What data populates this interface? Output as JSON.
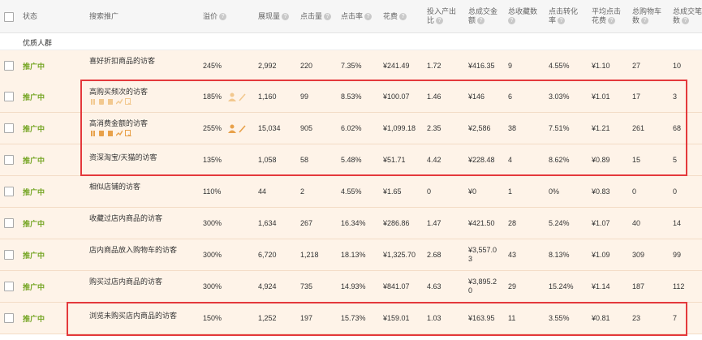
{
  "header": {
    "status": "状态",
    "promo": "搜索推广",
    "premium": "溢价",
    "impressions": "展现量",
    "clicks": "点击量",
    "ctr": "点击率",
    "cost": "花费",
    "roi_l1": "投入产出",
    "roi_l2": "比",
    "gmv_l1": "总成交金",
    "gmv_l2": "额",
    "fav": "总收藏数",
    "cvr_l1": "点击转化",
    "cvr_l2": "率",
    "cpc_l1": "平均点击",
    "cpc_l2": "花费",
    "cart_l1": "总购物车",
    "cart_l2": "数",
    "orders_l1": "总成交笔",
    "orders_l2": "数"
  },
  "group_label": "优质人群",
  "help_icon": "?",
  "rows": [
    {
      "status": "推广中",
      "name": "喜好折扣商品的访客",
      "premium": "245%",
      "impressions": "2,992",
      "clicks": "220",
      "ctr": "7.35%",
      "cost": "¥241.49",
      "roi": "1.72",
      "gmv": "¥416.35",
      "gmv2": "",
      "fav": "9",
      "cvr": "4.55%",
      "cpc": "¥1.10",
      "cart": "27",
      "orders": "10"
    },
    {
      "status": "推广中",
      "name": "高购买频次的访客",
      "premium": "185%",
      "impressions": "1,160",
      "clicks": "99",
      "ctr": "8.53%",
      "cost": "¥100.07",
      "roi": "1.46",
      "gmv": "¥146",
      "gmv2": "",
      "fav": "6",
      "cvr": "3.03%",
      "cpc": "¥1.01",
      "cart": "17",
      "orders": "3"
    },
    {
      "status": "推广中",
      "name": "高消费金额的访客",
      "premium": "255%",
      "impressions": "15,034",
      "clicks": "905",
      "ctr": "6.02%",
      "cost": "¥1,099.18",
      "roi": "2.35",
      "gmv": "¥2,586",
      "gmv2": "",
      "fav": "38",
      "cvr": "7.51%",
      "cpc": "¥1.21",
      "cart": "261",
      "orders": "68"
    },
    {
      "status": "推广中",
      "name": "资深淘宝/天猫的访客",
      "premium": "135%",
      "impressions": "1,058",
      "clicks": "58",
      "ctr": "5.48%",
      "cost": "¥51.71",
      "roi": "4.42",
      "gmv": "¥228.48",
      "gmv2": "",
      "fav": "4",
      "cvr": "8.62%",
      "cpc": "¥0.89",
      "cart": "15",
      "orders": "5"
    },
    {
      "status": "推广中",
      "name": "相似店铺的访客",
      "premium": "110%",
      "impressions": "44",
      "clicks": "2",
      "ctr": "4.55%",
      "cost": "¥1.65",
      "roi": "0",
      "gmv": "¥0",
      "gmv2": "",
      "fav": "1",
      "cvr": "0%",
      "cpc": "¥0.83",
      "cart": "0",
      "orders": "0"
    },
    {
      "status": "推广中",
      "name": "收藏过店内商品的访客",
      "premium": "300%",
      "impressions": "1,634",
      "clicks": "267",
      "ctr": "16.34%",
      "cost": "¥286.86",
      "roi": "1.47",
      "gmv": "¥421.50",
      "gmv2": "",
      "fav": "28",
      "cvr": "5.24%",
      "cpc": "¥1.07",
      "cart": "40",
      "orders": "14"
    },
    {
      "status": "推广中",
      "name": "店内商品放入购物车的访客",
      "premium": "300%",
      "impressions": "6,720",
      "clicks": "1,218",
      "ctr": "18.13%",
      "cost": "¥1,325.70",
      "roi": "2.68",
      "gmv": "¥3,557.0",
      "gmv2": "3",
      "fav": "43",
      "cvr": "8.13%",
      "cpc": "¥1.09",
      "cart": "309",
      "orders": "99"
    },
    {
      "status": "推广中",
      "name": "购买过店内商品的访客",
      "premium": "300%",
      "impressions": "4,924",
      "clicks": "735",
      "ctr": "14.93%",
      "cost": "¥841.07",
      "roi": "4.63",
      "gmv": "¥3,895.2",
      "gmv2": "0",
      "fav": "29",
      "cvr": "15.24%",
      "cpc": "¥1.14",
      "cart": "187",
      "orders": "112"
    },
    {
      "status": "推广中",
      "name": "浏览未购买店内商品的访客",
      "premium": "150%",
      "impressions": "1,252",
      "clicks": "197",
      "ctr": "15.73%",
      "cost": "¥159.01",
      "roi": "1.03",
      "gmv": "¥163.95",
      "gmv2": "",
      "fav": "11",
      "cvr": "3.55%",
      "cpc": "¥0.81",
      "cart": "23",
      "orders": "7"
    }
  ],
  "colors": {
    "status": "#75a524",
    "accent": "#e8a14a",
    "highlight": "#e4393c"
  }
}
